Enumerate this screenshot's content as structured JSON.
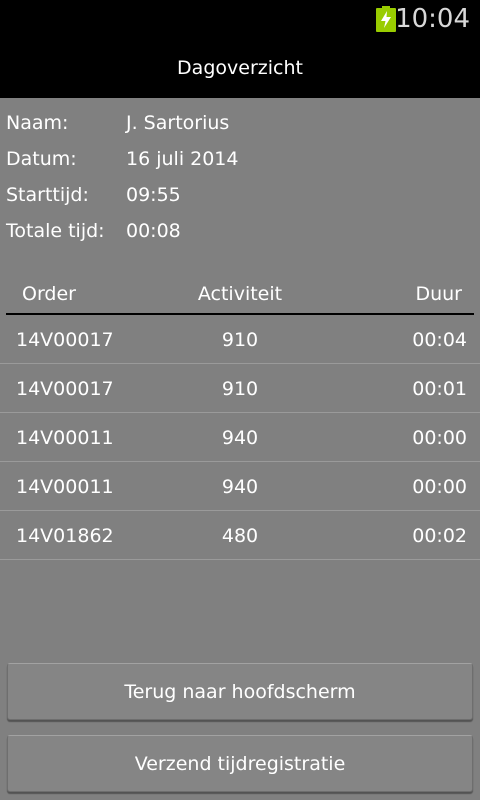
{
  "status_bar": {
    "time": "10:04",
    "battery_icon": "battery-charging-icon",
    "battery_color": "#99cc00"
  },
  "header": {
    "title": "Dagoverzicht",
    "background": "#000000"
  },
  "info": {
    "name_label": "Naam:",
    "name_value": "J. Sartorius",
    "date_label": "Datum:",
    "date_value": "16 juli 2014",
    "start_label": "Starttijd:",
    "start_value": "09:55",
    "total_label": "Totale tijd:",
    "total_value": "00:08"
  },
  "table": {
    "columns": [
      "Order",
      "Activiteit",
      "Duur"
    ],
    "rows": [
      {
        "order": "14V00017",
        "activity": "910",
        "duration": "00:04"
      },
      {
        "order": "14V00017",
        "activity": "910",
        "duration": "00:01"
      },
      {
        "order": "14V00011",
        "activity": "940",
        "duration": "00:00"
      },
      {
        "order": "14V00011",
        "activity": "940",
        "duration": "00:00"
      },
      {
        "order": "14V01862",
        "activity": "480",
        "duration": "00:02"
      }
    ]
  },
  "buttons": {
    "back_label": "Terug naar hoofdscherm",
    "send_label": "Verzend tijdregistratie"
  },
  "colors": {
    "background": "#808080",
    "text": "#ffffff"
  }
}
